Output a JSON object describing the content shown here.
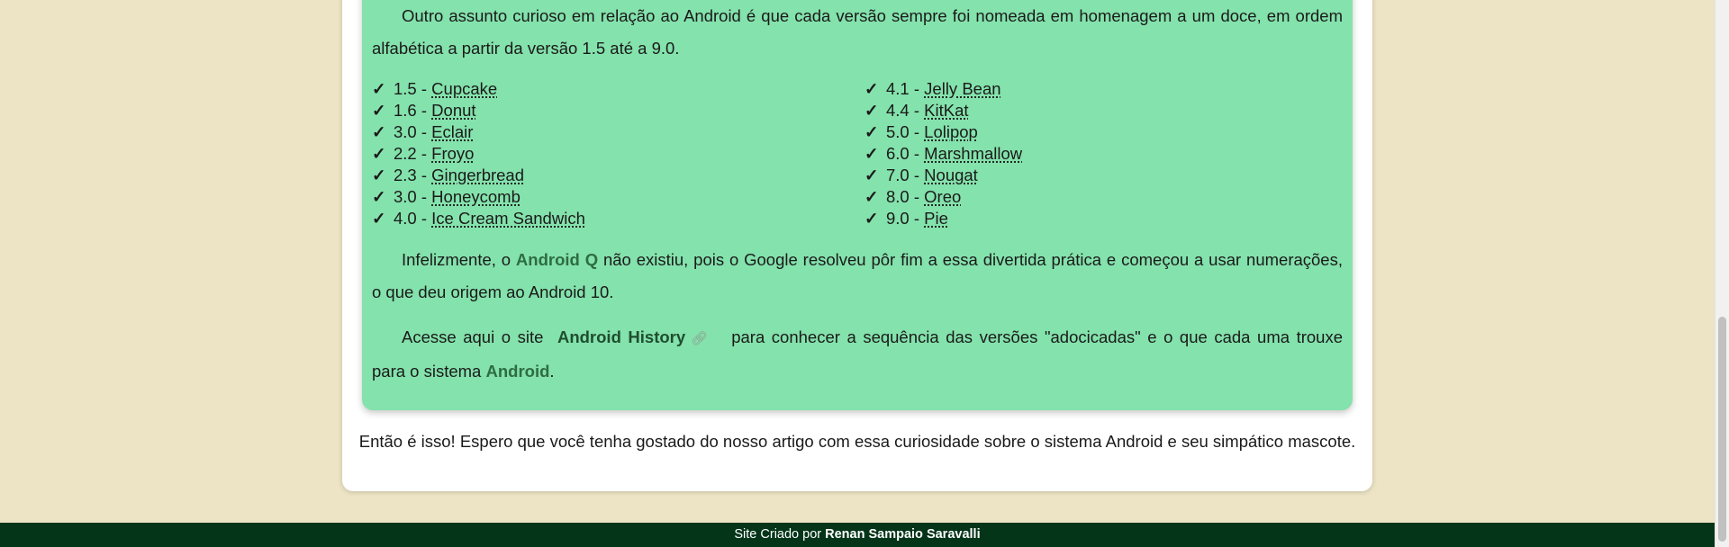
{
  "article": {
    "intro": "Outro assunto curioso em relação ao Android é que cada versão sempre foi nomeada em homenagem a um doce, em ordem alfabética a partir da versão 1.5 até a 9.0.",
    "versions_left": [
      {
        "number": "1.5",
        "name": "Cupcake"
      },
      {
        "number": "1.6",
        "name": "Donut"
      },
      {
        "number": "3.0",
        "name": "Eclair"
      },
      {
        "number": "2.2",
        "name": "Froyo"
      },
      {
        "number": "2.3",
        "name": "Gingerbread"
      },
      {
        "number": "3.0",
        "name": "Honeycomb"
      },
      {
        "number": "4.0",
        "name": "Ice Cream Sandwich"
      }
    ],
    "versions_right": [
      {
        "number": "4.1",
        "name": "Jelly Bean"
      },
      {
        "number": "4.4",
        "name": "KitKat"
      },
      {
        "number": "5.0",
        "name": "Lolipop"
      },
      {
        "number": "6.0",
        "name": "Marshmallow"
      },
      {
        "number": "7.0",
        "name": "Nougat"
      },
      {
        "number": "8.0",
        "name": "Oreo"
      },
      {
        "number": "9.0",
        "name": "Pie"
      }
    ],
    "check_glyph": "✓",
    "separator": " - ",
    "p2": {
      "before": "Infelizmente, o ",
      "highlight": "Android Q",
      "after": " não existiu, pois o Google resolveu pôr fim a essa divertida prática e começou a usar numerações, o que deu origem ao Android 10."
    },
    "p3": {
      "before": "Acesse aqui o site ",
      "link_label": "Android History",
      "link_icon": "external-link-icon",
      "after": "para conhecer a sequência das versões \"adocicadas\" e o que cada uma trouxe para o sistema ",
      "highlight": "Android",
      "end": "."
    },
    "closing": "Então é isso! Espero que você tenha gostado do nosso artigo com essa curiosidade sobre o sistema Android e seu simpático mascote."
  },
  "footer": {
    "prefix": "Site Criado por ",
    "author": "Renan Sampaio Saravalli"
  },
  "colors": {
    "page_background": "#ece4c4",
    "card_background": "#ffffff",
    "highlight_box": "#84e2ac",
    "highlight_text": "#2e6c41",
    "footer_background": "#043519"
  }
}
